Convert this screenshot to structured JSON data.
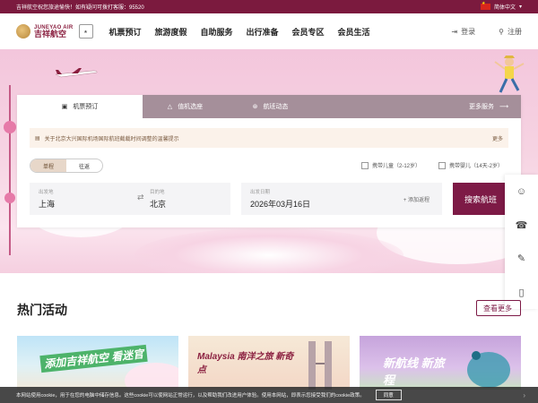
{
  "topbar": {
    "notice": "吉祥航空祝您旅途愉快！如有疑问可拨打客服：95520",
    "language": "简体中文"
  },
  "nav": {
    "logo_en": "JUNEYAO AIR",
    "logo_cn": "吉祥航空",
    "items": [
      "机票预订",
      "旅游度假",
      "自助服务",
      "出行准备",
      "会员专区",
      "会员生活"
    ],
    "login": "登录",
    "register": "注册"
  },
  "booking": {
    "tabs": [
      "机票预订",
      "值机选座",
      "航班动态"
    ],
    "more_services": "更多服务",
    "notice": "关于北京大兴国际机场国际航班截载时间调整的温馨提示",
    "notice_more": "更多",
    "trip_one_way": "单程",
    "trip_round": "往返",
    "child_option": "携带儿童（2-12岁）",
    "infant_option": "携带婴儿（14天-2岁）",
    "from_label": "出发地",
    "from_value": "上海",
    "to_label": "目的地",
    "to_value": "北京",
    "date_label": "出发日期",
    "date_value": "2026年03月16日",
    "add_return": "+ 添加返程",
    "search_button": "搜索航班"
  },
  "hot": {
    "title": "热门活动",
    "more": "查看更多",
    "cards": [
      {
        "text": "添加吉祥航空 看迷官"
      },
      {
        "text": "Malaysia 南洋之旅 新奇点"
      },
      {
        "text": "新航线 新旅程"
      }
    ]
  },
  "cookie": {
    "text": "本网站使用cookie，用于在您的电脑中储存信息。这些cookie可以使网站正常运行，以及帮助我们改进用户体验。使用本网站，即表示您接受我们的cookie政策。",
    "ok": "同意"
  },
  "colors": {
    "brand": "#7d1a46",
    "topbar": "#7b1a3e"
  }
}
